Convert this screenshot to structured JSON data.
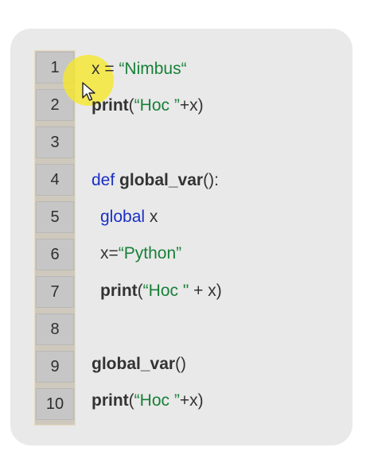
{
  "line_numbers": [
    "1",
    "2",
    "3",
    "4",
    "5",
    "6",
    "7",
    "8",
    "9",
    "10"
  ],
  "code": {
    "l1": {
      "var": "x = ",
      "str": "“Nimbus“"
    },
    "l2": {
      "fn": "print",
      "open": "(",
      "str": "“Hoc ”",
      "rest": "+x)"
    },
    "l4": {
      "kw": "def",
      "space": " ",
      "name": "global_var",
      "rest": "():"
    },
    "l5": {
      "kw": "global",
      "rest": " x"
    },
    "l6": {
      "var": "x=",
      "str": "“Python”"
    },
    "l7": {
      "fn": "print",
      "open": "(",
      "str": "“Hoc \"",
      "rest": " + x)"
    },
    "l9": {
      "name": "global_var",
      "rest": "()"
    },
    "l10": {
      "fn": "print",
      "open": "(",
      "str": "“Hoc ”",
      "rest": "+x)"
    }
  },
  "colors": {
    "string": "#188038",
    "function": "#9b1a9b",
    "keyword": "#1a2fc4",
    "highlight": "#f6e828"
  },
  "icons": {
    "cursor": "mouse-pointer-icon"
  }
}
